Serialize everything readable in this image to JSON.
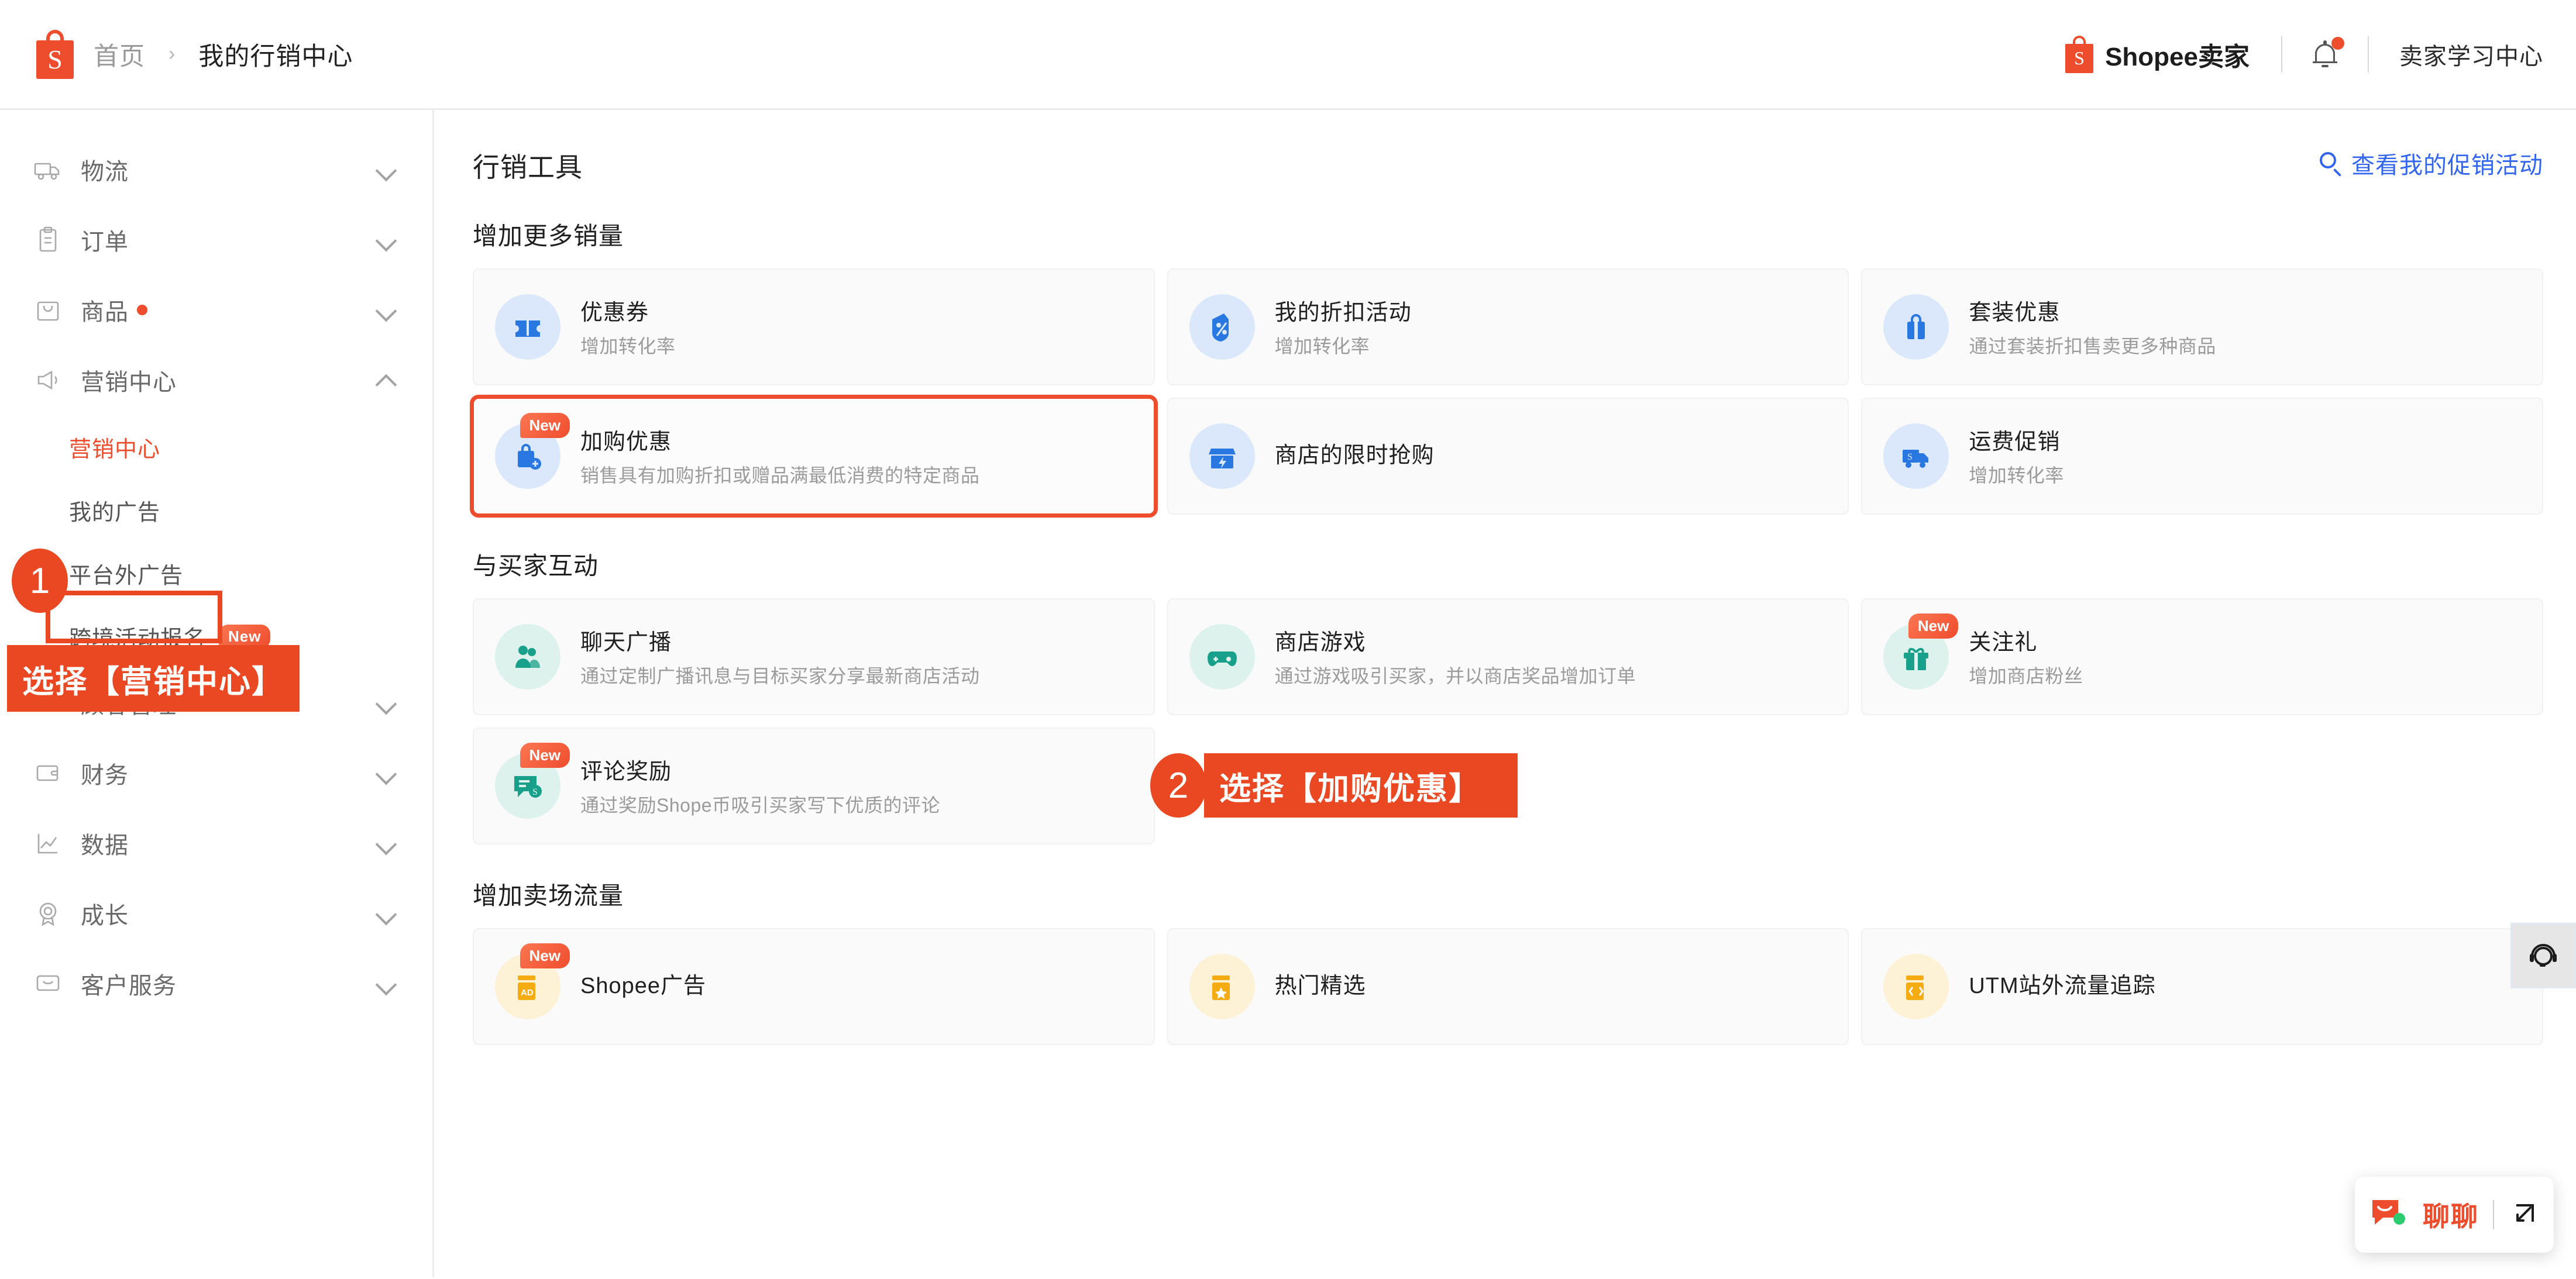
{
  "header": {
    "breadcrumb": {
      "home": "首页",
      "separator": "›",
      "current": "我的行销中心"
    },
    "logo_text": "Shopee卖家",
    "logo_letter": "S",
    "learning_center": "卖家学习中心"
  },
  "sidebar": {
    "items": [
      {
        "label": "物流",
        "icon": "truck-icon",
        "expanded": false,
        "dot": false
      },
      {
        "label": "订单",
        "icon": "clipboard-icon",
        "expanded": false,
        "dot": false
      },
      {
        "label": "商品",
        "icon": "bag-icon",
        "expanded": false,
        "dot": true
      },
      {
        "label": "营销中心",
        "icon": "megaphone-icon",
        "expanded": true,
        "dot": false
      }
    ],
    "marketing_subitems": [
      {
        "label": "营销中心",
        "active": true,
        "badge": ""
      },
      {
        "label": "我的广告",
        "active": false,
        "badge": ""
      },
      {
        "label": "平台外广告",
        "active": false,
        "badge": ""
      },
      {
        "label": "跨境活动报名",
        "active": false,
        "badge": "New"
      }
    ],
    "items_bottom": [
      {
        "label": "顾客管理",
        "icon": "user-icon",
        "expanded": false
      },
      {
        "label": "财务",
        "icon": "wallet-icon",
        "expanded": false
      },
      {
        "label": "数据",
        "icon": "chart-icon",
        "expanded": false
      },
      {
        "label": "成长",
        "icon": "medal-icon",
        "expanded": false
      },
      {
        "label": "客户服务",
        "icon": "chat-icon",
        "expanded": false
      }
    ]
  },
  "main": {
    "page_title": "行销工具",
    "view_promotions": "查看我的促销活动",
    "sections": [
      {
        "title": "增加更多销量",
        "cards": [
          {
            "title": "优惠券",
            "desc": "增加转化率",
            "icon": "coupon-icon",
            "tone": "blue",
            "badge": ""
          },
          {
            "title": "我的折扣活动",
            "desc": "增加转化率",
            "icon": "discount-tag-icon",
            "tone": "blue",
            "badge": ""
          },
          {
            "title": "套装优惠",
            "desc": "通过套装折扣售卖更多种商品",
            "icon": "bundle-icon",
            "tone": "blue",
            "badge": ""
          },
          {
            "title": "加购优惠",
            "desc": "销售具有加购折扣或赠品满最低消费的特定商品",
            "icon": "add-on-bag-icon",
            "tone": "blue",
            "badge": "New",
            "highlight": true
          },
          {
            "title": "商店的限时抢购",
            "desc": "",
            "icon": "shop-flash-icon",
            "tone": "blue",
            "badge": ""
          },
          {
            "title": "运费促销",
            "desc": "增加转化率",
            "icon": "shipping-truck-icon",
            "tone": "blue",
            "badge": ""
          }
        ]
      },
      {
        "title": "与买家互动",
        "cards": [
          {
            "title": "聊天广播",
            "desc": "通过定制广播讯息与目标买家分享最新商店活动",
            "icon": "people-icon",
            "tone": "teal",
            "badge": ""
          },
          {
            "title": "商店游戏",
            "desc": "通过游戏吸引买家，并以商店奖品增加订单",
            "icon": "gamepad-icon",
            "tone": "teal",
            "badge": ""
          },
          {
            "title": "关注礼",
            "desc": "增加商店粉丝",
            "icon": "gift-icon",
            "tone": "teal",
            "badge": "New"
          },
          {
            "title": "评论奖励",
            "desc": "通过奖励Shope币吸引买家写下优质的评论",
            "icon": "review-coin-icon",
            "tone": "teal",
            "badge": "New"
          }
        ]
      },
      {
        "title": "增加卖场流量",
        "cards": [
          {
            "title": "Shopee广告",
            "desc": "",
            "icon": "ad-icon",
            "tone": "amber",
            "badge": "New"
          },
          {
            "title": "热门精选",
            "desc": "",
            "icon": "star-icon",
            "tone": "amber",
            "badge": ""
          },
          {
            "title": "UTM站外流量追踪",
            "desc": "",
            "icon": "code-icon",
            "tone": "amber",
            "badge": ""
          }
        ]
      }
    ]
  },
  "annotations": [
    {
      "number": "1",
      "text": "选择【营销中心】",
      "target": "营销中心"
    },
    {
      "number": "2",
      "text": "选择【加购优惠】",
      "target": "加购优惠"
    }
  ],
  "floating": {
    "support_icon": "headset-icon",
    "chat_label": "聊聊",
    "chat_icon": "chat-bubble-icon",
    "expand_icon": "expand-icon"
  },
  "colors": {
    "brand": "#ee4d2d",
    "annotation": "#ea4822",
    "link": "#3366ee",
    "icon_blue": "#2977e0",
    "icon_teal": "#19a08a",
    "icon_amber": "#f5ab12"
  }
}
